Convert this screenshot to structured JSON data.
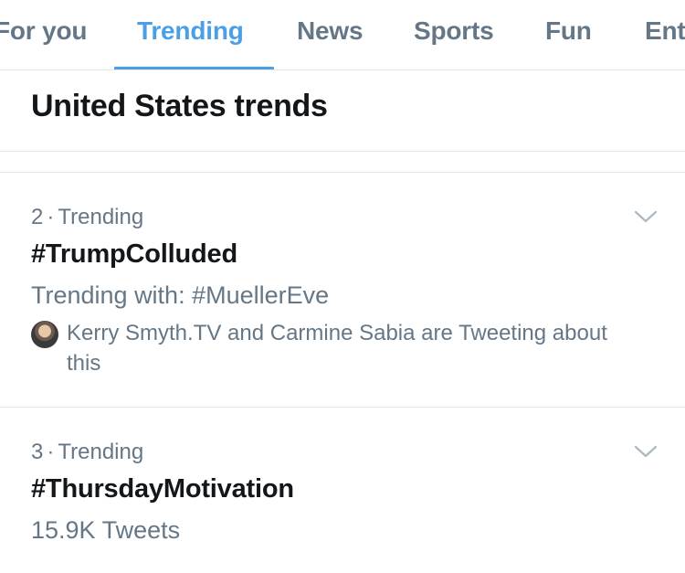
{
  "tabs": [
    {
      "label": "For you"
    },
    {
      "label": "Trending"
    },
    {
      "label": "News"
    },
    {
      "label": "Sports"
    },
    {
      "label": "Fun"
    },
    {
      "label": "Ent"
    }
  ],
  "active_tab": "Trending",
  "section": {
    "title": "United States trends"
  },
  "trends": [
    {
      "rank": "2",
      "category": "Trending",
      "name": "#TrumpColluded",
      "context": "Trending with: #MuellerEve",
      "social": "Kerry Smyth.TV and Carmine Sabia are Tweeting about this"
    },
    {
      "rank": "3",
      "category": "Trending",
      "name": "#ThursdayMotivation",
      "context": "15.9K Tweets"
    }
  ],
  "separator": "·",
  "icons": {
    "more": "chevron-down-icon",
    "avatar": "avatar"
  },
  "colors": {
    "accent": "#4a9fe6",
    "text": "#14171a",
    "secondary": "#657786",
    "divider": "#e1e8ed"
  }
}
